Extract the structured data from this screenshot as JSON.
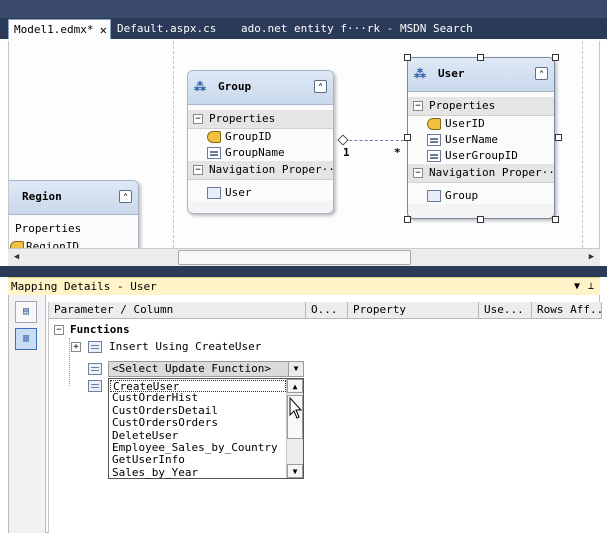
{
  "tabs": [
    {
      "label": "Model1.edmx*",
      "active": true
    },
    {
      "label": "Default.aspx.cs",
      "active": false
    },
    {
      "label": "ado.net entity f···rk - MSDN Search",
      "active": false
    }
  ],
  "designer": {
    "entities": {
      "group": {
        "title": "Group",
        "properties_label": "Properties",
        "properties": [
          "GroupID",
          "GroupName"
        ],
        "navigation_label": "Navigation Proper···",
        "navigation": [
          "User"
        ]
      },
      "user": {
        "title": "User",
        "properties_label": "Properties",
        "properties": [
          "UserID",
          "UserName",
          "UserGroupID"
        ],
        "navigation_label": "Navigation Proper···",
        "navigation": [
          "Group"
        ]
      },
      "region": {
        "title": "Region",
        "properties_label": "Properties",
        "properties": [
          "RegionID"
        ]
      }
    },
    "association": {
      "left_multiplicity": "1",
      "right_multiplicity": "*"
    }
  },
  "mapping": {
    "title": "Mapping Details - User",
    "columns": [
      "Parameter / Column",
      "O...",
      "Property",
      "Use...",
      "Rows Aff..."
    ],
    "functions_label": "Functions",
    "insert_label": "Insert Using CreateUser",
    "combo_value": "<Select Update Function>",
    "options": [
      "CreateUser",
      "CustOrderHist",
      "CustOrdersDetail",
      "CustOrdersOrders",
      "DeleteUser",
      "Employee_Sales_by_Country",
      "GetUserInfo",
      "Sales_by_Year"
    ],
    "selected_option": "CreateUser"
  },
  "colors": {
    "chrome_dark": "#2b3a58",
    "panel_title": "#fff4c8",
    "entity_header": "#c9d8ec"
  },
  "icons": [
    "entity-icon",
    "collapse-icon",
    "key-icon",
    "property-icon",
    "navigation-icon",
    "pin-icon",
    "dropdown-icon",
    "function-icon",
    "cursor-icon"
  ]
}
